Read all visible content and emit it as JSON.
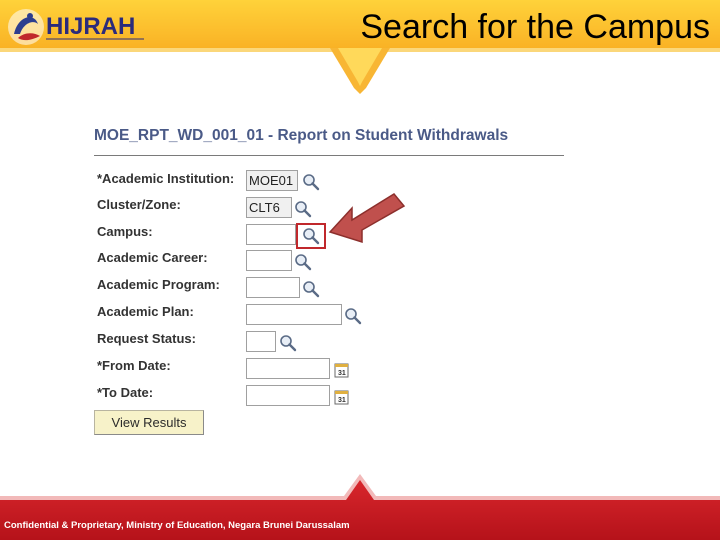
{
  "slide": {
    "title": "Search for the Campus"
  },
  "logo": {
    "text": "HIJRAH"
  },
  "form": {
    "title": "MOE_RPT_WD_001_01 - Report on Student Withdrawals",
    "fields": [
      {
        "label": "*Academic Institution:",
        "value": "MOE01"
      },
      {
        "label": "Cluster/Zone:",
        "value": "CLT6"
      },
      {
        "label": "Campus:",
        "value": ""
      },
      {
        "label": "Academic Career:",
        "value": ""
      },
      {
        "label": "Academic Program:",
        "value": ""
      },
      {
        "label": "Academic Plan:",
        "value": ""
      },
      {
        "label": "Request Status:",
        "value": ""
      },
      {
        "label": "*From Date:",
        "value": ""
      },
      {
        "label": "*To Date:",
        "value": ""
      }
    ],
    "view_results_label": "View Results",
    "calendar_glyph": "31"
  },
  "footer": {
    "text": "Confidential & Proprietary, Ministry of Education, Negara Brunei Darussalam"
  },
  "colors": {
    "header_orange": "#f9a51b",
    "header_yellow": "#ffe070",
    "footer_red": "#c4141b",
    "arrow": "#c0504d"
  }
}
